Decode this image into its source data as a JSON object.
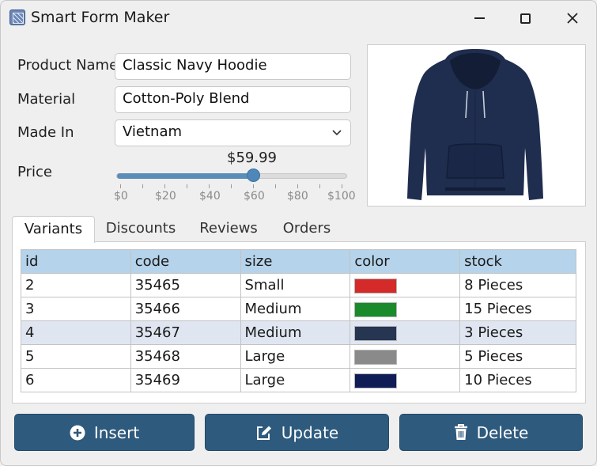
{
  "window": {
    "title": "Smart Form Maker",
    "icon": "app-icon"
  },
  "form": {
    "product_name": {
      "label": "Product Name",
      "value": "Classic Navy Hoodie"
    },
    "material": {
      "label": "Material",
      "value": "Cotton-Poly Blend"
    },
    "made_in": {
      "label": "Made In",
      "value": "Vietnam"
    },
    "price": {
      "label": "Price",
      "value_text": "$59.99",
      "value": 59.99,
      "min": 0,
      "max": 100,
      "tick_labels": [
        "$0",
        "$20",
        "$40",
        "$60",
        "$80",
        "$100"
      ]
    }
  },
  "product_image": {
    "subject": "navy hoodie",
    "colors": {
      "body": "#1f2d4f",
      "shadow": "#131d36"
    }
  },
  "tabs": [
    {
      "label": "Variants",
      "active": true
    },
    {
      "label": "Discounts",
      "active": false
    },
    {
      "label": "Reviews",
      "active": false
    },
    {
      "label": "Orders",
      "active": false
    }
  ],
  "table": {
    "columns": [
      "id",
      "code",
      "size",
      "color",
      "stock"
    ],
    "rows": [
      {
        "id": "2",
        "code": "35465",
        "size": "Small",
        "color": "#d42a2a",
        "stock": "8 Pieces",
        "selected": false
      },
      {
        "id": "3",
        "code": "35466",
        "size": "Medium",
        "color": "#1b8a2b",
        "stock": "15 Pieces",
        "selected": false
      },
      {
        "id": "4",
        "code": "35467",
        "size": "Medium",
        "color": "#253552",
        "stock": "3 Pieces",
        "selected": true
      },
      {
        "id": "5",
        "code": "35468",
        "size": "Large",
        "color": "#8a8a8a",
        "stock": "5 Pieces",
        "selected": false
      },
      {
        "id": "6",
        "code": "35469",
        "size": "Large",
        "color": "#101c55",
        "stock": "10 Pieces",
        "selected": false
      }
    ]
  },
  "buttons": {
    "insert": {
      "label": "Insert",
      "icon": "plus-circle-icon"
    },
    "update": {
      "label": "Update",
      "icon": "edit-icon"
    },
    "delete": {
      "label": "Delete",
      "icon": "trash-icon"
    }
  },
  "colors": {
    "accent": "#2e5a7d",
    "table_header": "#b5d3ea",
    "selected_row": "#dfe6f1",
    "slider": "#5b8db8"
  }
}
